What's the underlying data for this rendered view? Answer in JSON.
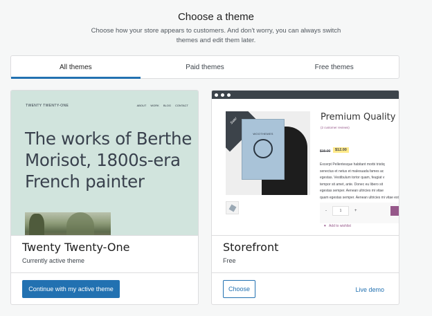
{
  "header": {
    "title": "Choose a theme",
    "subtitle_line1": "Choose how your store appears to customers. And don't worry, you can always switch",
    "subtitle_line2": "themes and edit them later."
  },
  "tabs": [
    {
      "label": "All themes",
      "active": true
    },
    {
      "label": "Paid themes",
      "active": false
    },
    {
      "label": "Free themes",
      "active": false
    }
  ],
  "themes": [
    {
      "name": "Twenty Twenty-One",
      "status": "Currently active theme",
      "button_label": "Continue with my active theme",
      "preview": {
        "site_title": "TWENTY TWENTY-ONE",
        "nav": [
          "ABOUT",
          "WORK",
          "BLOG",
          "CONTACT"
        ],
        "heading_line1": "The works of Berthe",
        "heading_line2": "Morisot, 1800s-era",
        "heading_line3": "French painter",
        "background_color": "#d1e4dd"
      }
    },
    {
      "name": "Storefront",
      "status": "Free",
      "button_label": "Choose",
      "link_label": "Live demo",
      "preview": {
        "sale_badge": "Sale!",
        "poster_text": "WOOTHEMES",
        "product_title": "Premium Quality",
        "reviews": "(2 customer reviews)",
        "old_price": "$15.00",
        "new_price": "$12.00",
        "description_lines": [
          "Excerpt Pellentesque habitant morbi tristiq",
          "senectus et netus et malesuada fames ac",
          "egestas. Vestibulum tortor quam, feugiat v",
          "tempor sit amet, ante. Donec eu libero sit",
          "egestas semper. Aenean ultricies mi vitae",
          "quam egestas semper. Aenean ultricies mi vitae est."
        ],
        "quantity_minus": "-",
        "quantity": "1",
        "quantity_plus": "+",
        "wishlist": "Add to wishlist"
      }
    }
  ],
  "colors": {
    "accent": "#2271b1",
    "storefront_accent": "#96588a"
  }
}
